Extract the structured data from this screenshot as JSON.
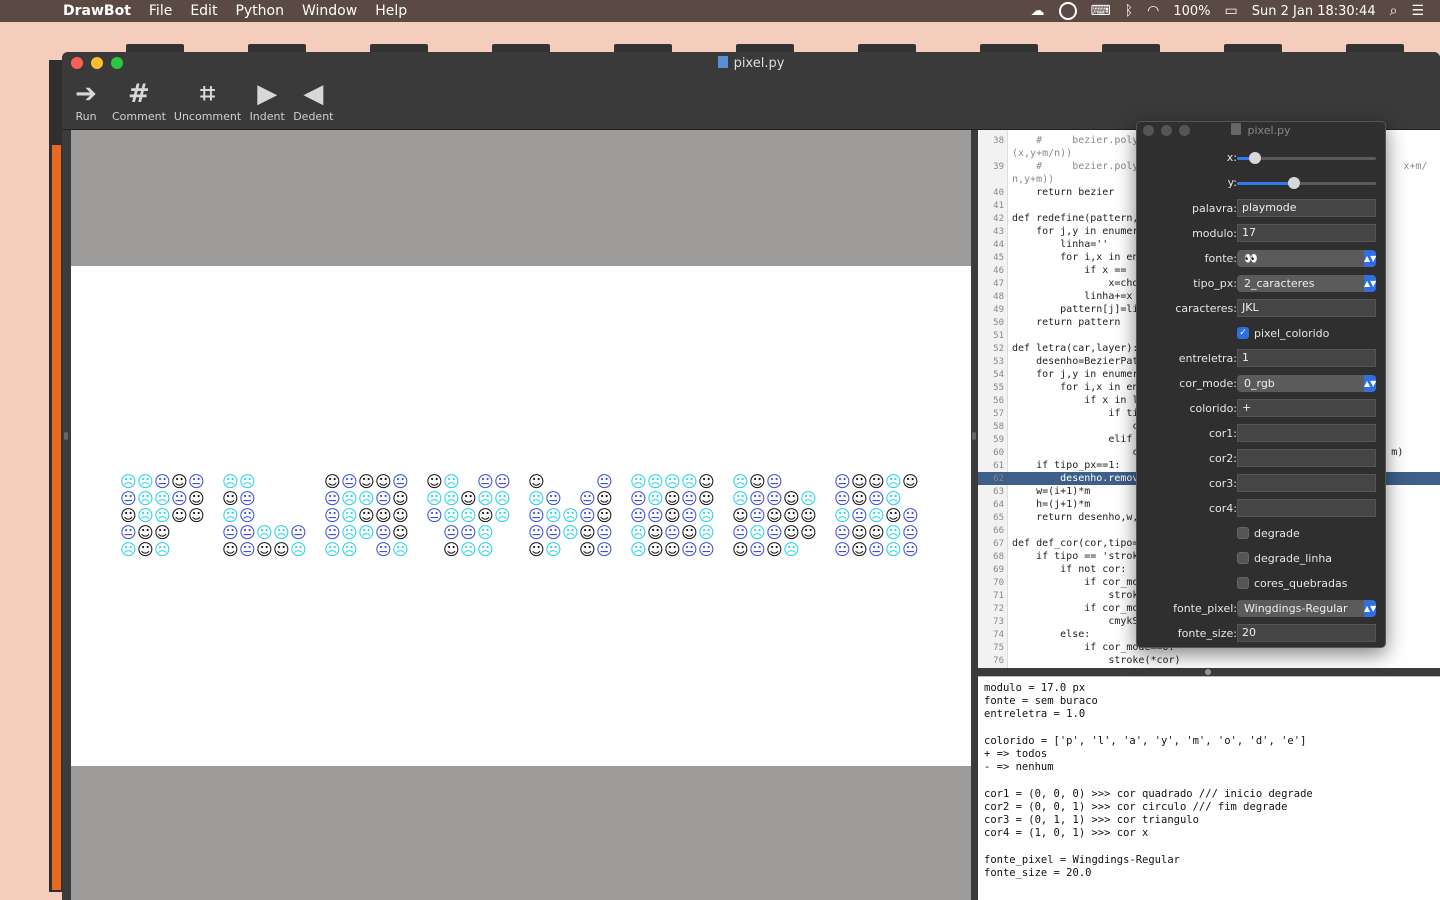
{
  "menubar": {
    "apple": "",
    "app_name": "DrawBot",
    "items": [
      "File",
      "Edit",
      "Python",
      "Window",
      "Help"
    ],
    "battery": "100%",
    "datetime": "Sun 2 Jan  18:30:44"
  },
  "window": {
    "title": "pixel.py",
    "toolbar": [
      {
        "label": "Run",
        "icon": "run-arrow-icon",
        "glyph": "➔"
      },
      {
        "label": "Comment",
        "icon": "comment-hash-icon",
        "glyph": "#"
      },
      {
        "label": "Uncomment",
        "icon": "uncomment-hash-icon",
        "glyph": "⌗"
      },
      {
        "label": "Indent",
        "icon": "indent-arrow-icon",
        "glyph": "▶"
      },
      {
        "label": "Dedent",
        "icon": "dedent-arrow-icon",
        "glyph": "◀"
      }
    ]
  },
  "canvas": {
    "faces": {
      "happy": "☺",
      "sad": "☹",
      "neutral": "😐"
    },
    "colors": {
      "black": "#111111",
      "cyan": "#2ad3e6",
      "blue": "#3d4fd9"
    }
  },
  "code": [
    {
      "n": "38",
      "t": "    #     bezier.poly",
      "c": "cm"
    },
    {
      "n": "",
      "t": "(x,y+m/n))",
      "c": "cm"
    },
    {
      "n": "39",
      "t": "    #     bezier.poly                                            x+m/",
      "c": "cm"
    },
    {
      "n": "",
      "t": "n,y+m))",
      "c": "cm"
    },
    {
      "n": "40",
      "t": "    return bezier",
      "c": ""
    },
    {
      "n": "41",
      "t": "",
      "c": ""
    },
    {
      "n": "42",
      "t": "def redefine(pattern,",
      "c": ""
    },
    {
      "n": "43",
      "t": "    for j,y in enumer",
      "c": ""
    },
    {
      "n": "44",
      "t": "        linha=''",
      "c": ""
    },
    {
      "n": "45",
      "t": "        for i,x in en",
      "c": ""
    },
    {
      "n": "46",
      "t": "            if x ==",
      "c": ""
    },
    {
      "n": "47",
      "t": "                x=cho",
      "c": ""
    },
    {
      "n": "48",
      "t": "            linha+=x",
      "c": ""
    },
    {
      "n": "49",
      "t": "        pattern[j]=li",
      "c": ""
    },
    {
      "n": "50",
      "t": "    return pattern",
      "c": ""
    },
    {
      "n": "51",
      "t": "",
      "c": ""
    },
    {
      "n": "52",
      "t": "def letra(car,layer):",
      "c": ""
    },
    {
      "n": "53",
      "t": "    desenho=BezierPat",
      "c": ""
    },
    {
      "n": "54",
      "t": "    for j,y in enumer",
      "c": ""
    },
    {
      "n": "55",
      "t": "        for i,x in en",
      "c": ""
    },
    {
      "n": "56",
      "t": "            if x in l",
      "c": ""
    },
    {
      "n": "57",
      "t": "                if ti",
      "c": ""
    },
    {
      "n": "58",
      "t": "                    c",
      "c": ""
    },
    {
      "n": "59",
      "t": "                elif",
      "c": ""
    },
    {
      "n": "60",
      "t": "                    c                                          m)",
      "c": ""
    },
    {
      "n": "61",
      "t": "    if tipo_px==1:",
      "c": ""
    },
    {
      "n": "62",
      "t": "        desenho.remov",
      "c": "hl"
    },
    {
      "n": "63",
      "t": "    w=(i+1)*m",
      "c": ""
    },
    {
      "n": "64",
      "t": "    h=(j+1)*m",
      "c": ""
    },
    {
      "n": "65",
      "t": "    return desenho,w,",
      "c": ""
    },
    {
      "n": "66",
      "t": "",
      "c": ""
    },
    {
      "n": "67",
      "t": "def def_cor(cor,tipo=",
      "c": ""
    },
    {
      "n": "68",
      "t": "    if tipo == 'strok",
      "c": ""
    },
    {
      "n": "69",
      "t": "        if not cor:",
      "c": ""
    },
    {
      "n": "70",
      "t": "            if cor_mo",
      "c": ""
    },
    {
      "n": "71",
      "t": "                strok",
      "c": ""
    },
    {
      "n": "72",
      "t": "            if cor_mo",
      "c": ""
    },
    {
      "n": "73",
      "t": "                cmykS",
      "c": ""
    },
    {
      "n": "74",
      "t": "        else:",
      "c": ""
    },
    {
      "n": "75",
      "t": "            if cor_mode==0:",
      "c": ""
    },
    {
      "n": "76",
      "t": "                stroke(*cor)",
      "c": ""
    }
  ],
  "output": [
    "modulo = 17.0 px",
    "fonte = sem buraco",
    "entreletra = 1.0",
    "",
    "colorido = ['p', 'l', 'a', 'y', 'm', 'o', 'd', 'e']",
    "+ => todos",
    "- => nenhum",
    "",
    "cor1 = (0, 0, 0) >>> cor quadrado /// inicio degrade",
    "cor2 = (0, 0, 1) >>> cor circulo /// fim degrade",
    "cor3 = (0, 1, 1) >>> cor triangulo",
    "cor4 = (1, 0, 1) >>> cor x",
    "",
    "fonte_pixel = Wingdings-Regular",
    "fonte_size = 20.0"
  ],
  "panel": {
    "title": "pixel.py",
    "x_label": "x:",
    "x_value": 0.13,
    "y_label": "y:",
    "y_value": 0.41,
    "palavra_label": "palavra:",
    "palavra": "playmode",
    "modulo_label": "modulo:",
    "modulo": "17",
    "fonte_label": "fonte:",
    "fonte": "👀",
    "tipo_px_label": "tipo_px:",
    "tipo_px": "2_caracteres",
    "caracteres_label": "caracteres:",
    "caracteres": "JKL",
    "pixel_colorido_label": "pixel_colorido",
    "pixel_colorido": true,
    "entreletra_label": "entreletra:",
    "entreletra": "1",
    "cor_mode_label": "cor_mode:",
    "cor_mode": "0_rgb",
    "colorido_label": "colorido:",
    "colorido": "+",
    "cor1_label": "cor1:",
    "cor1": "",
    "cor2_label": "cor2:",
    "cor2": "",
    "cor3_label": "cor3:",
    "cor3": "",
    "cor4_label": "cor4:",
    "cor4": "",
    "degrade_label": "degrade",
    "degrade": false,
    "degrade_linha_label": "degrade_linha",
    "degrade_linha": false,
    "cores_quebradas_label": "cores_quebradas",
    "cores_quebradas": false,
    "fonte_pixel_label": "fonte_pixel:",
    "fonte_pixel": "Wingdings-Regular",
    "fonte_size_label": "fonte_size:",
    "fonte_size": "20"
  }
}
